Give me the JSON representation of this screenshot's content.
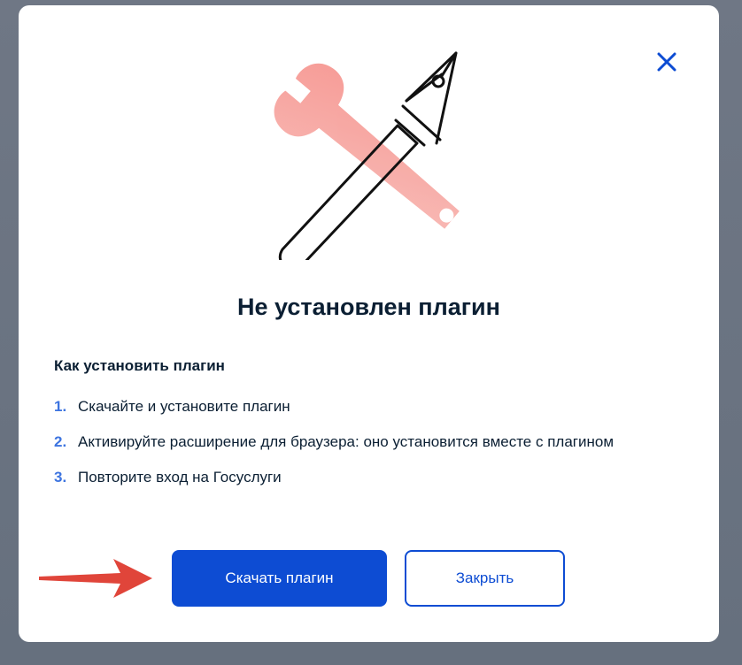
{
  "dialog": {
    "title": "Не установлен плагин",
    "close_icon": "close-icon",
    "illustration_icon": "wrench-and-pen-icon",
    "steps_heading": "Как установить плагин",
    "steps": [
      {
        "num": "1.",
        "text": "Скачайте и установите плагин"
      },
      {
        "num": "2.",
        "text": "Активируйте расширение для браузера: оно установится вместе с плагином"
      },
      {
        "num": "3.",
        "text": "Повторите вход на Госуслуги"
      }
    ],
    "buttons": {
      "download_label": "Скачать плагин",
      "close_label": "Закрыть"
    }
  },
  "annotation": {
    "arrow_icon": "right-arrow-icon"
  },
  "colors": {
    "primary": "#0d4cd3",
    "accent_number": "#3d74e0",
    "text": "#0b1f33",
    "wrench": "#f59a93",
    "annotation_arrow": "#e0453a",
    "backdrop": "#6e7684"
  }
}
